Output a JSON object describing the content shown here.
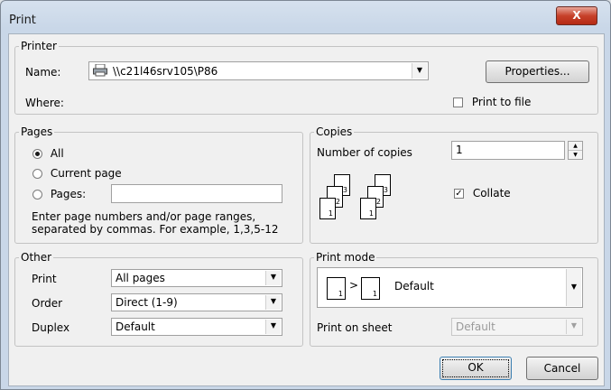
{
  "window": {
    "title": "Print",
    "close_glyph": "X"
  },
  "printer": {
    "legend": "Printer",
    "name_label": "Name:",
    "name_value": "\\\\c21l46srv105\\P86",
    "where_label": "Where:",
    "properties_label": "Properties...",
    "print_to_file_label": "Print to file"
  },
  "pages": {
    "legend": "Pages",
    "all_label": "All",
    "current_label": "Current page",
    "pages_label": "Pages:",
    "pages_value": "",
    "hint": "Enter page numbers and/or page ranges, separated by commas. For example, 1,3,5-12"
  },
  "copies": {
    "legend": "Copies",
    "number_label": "Number of copies",
    "number_value": "1",
    "collate_label": "Collate",
    "stack1": [
      "1",
      "2",
      "3"
    ],
    "stack2": [
      "1",
      "2",
      "3"
    ]
  },
  "other": {
    "legend": "Other",
    "print_label": "Print",
    "print_value": "All pages",
    "order_label": "Order",
    "order_value": "Direct (1-9)",
    "duplex_label": "Duplex",
    "duplex_value": "Default"
  },
  "print_mode": {
    "legend": "Print mode",
    "mode_value": "Default",
    "page_a": "1",
    "page_b": "1",
    "arrow": ">",
    "sheet_label": "Print on sheet",
    "sheet_value": "Default"
  },
  "footer": {
    "ok_label": "OK",
    "cancel_label": "Cancel"
  }
}
